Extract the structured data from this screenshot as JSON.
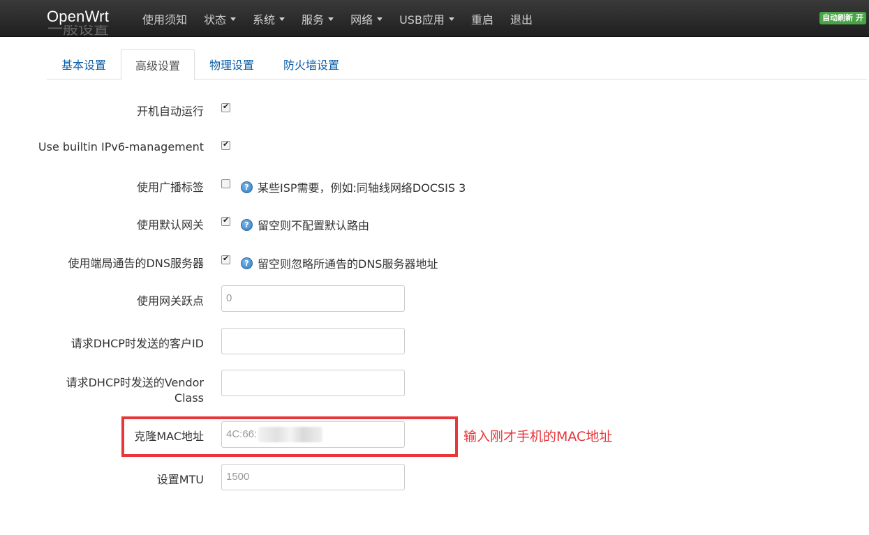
{
  "navbar": {
    "brand": "OpenWrt",
    "items": [
      {
        "label": "使用须知",
        "dropdown": false
      },
      {
        "label": "状态",
        "dropdown": true
      },
      {
        "label": "系统",
        "dropdown": true
      },
      {
        "label": "服务",
        "dropdown": true
      },
      {
        "label": "网络",
        "dropdown": true
      },
      {
        "label": "USB应用",
        "dropdown": true
      },
      {
        "label": "重启",
        "dropdown": false
      },
      {
        "label": "退出",
        "dropdown": false
      }
    ],
    "refresh_badge": "自动刷新 开",
    "badge_color": "#4aa447"
  },
  "section_heading": "一般设置",
  "tabs": [
    {
      "label": "基本设置",
      "active": false
    },
    {
      "label": "高级设置",
      "active": true
    },
    {
      "label": "物理设置",
      "active": false
    },
    {
      "label": "防火墙设置",
      "active": false
    }
  ],
  "form": {
    "autostart": {
      "label": "开机自动运行",
      "checked": true
    },
    "ipv6_mgmt": {
      "label": "Use builtin IPv6-management",
      "checked": true
    },
    "broadcast": {
      "label": "使用广播标签",
      "checked": false,
      "help": "某些ISP需要，例如:同轴线网络DOCSIS 3"
    },
    "default_gw": {
      "label": "使用默认网关",
      "checked": true,
      "help": "留空则不配置默认路由"
    },
    "peer_dns": {
      "label": "使用端局通告的DNS服务器",
      "checked": true,
      "help": "留空则忽略所通告的DNS服务器地址"
    },
    "metric": {
      "label": "使用网关跃点",
      "placeholder": "0"
    },
    "client_id": {
      "label": "请求DHCP时发送的客户ID",
      "value": ""
    },
    "vendor_class": {
      "label": "请求DHCP时发送的Vendor Class",
      "value": ""
    },
    "mac": {
      "label": "克隆MAC地址",
      "value": "4C:66:"
    },
    "mtu": {
      "label": "设置MTU",
      "placeholder": "1500"
    }
  },
  "annotation": {
    "text": "输入刚才手机的MAC地址",
    "color": "#e8363b"
  }
}
